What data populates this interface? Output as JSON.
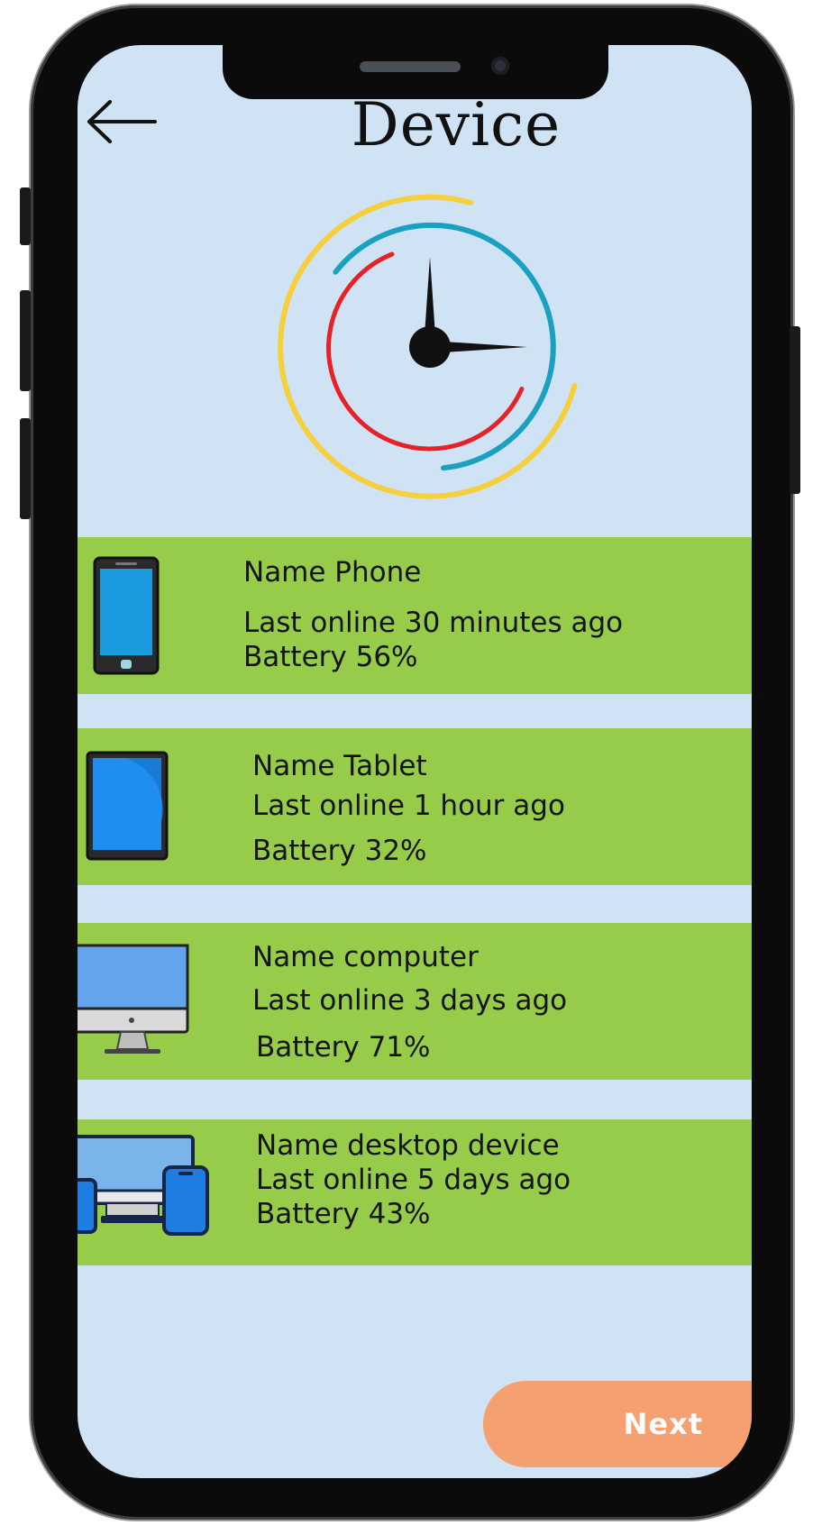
{
  "header": {
    "title": "Device",
    "back_icon": "arrow-left-icon"
  },
  "hero": {
    "icon": "clock-icon"
  },
  "devices": [
    {
      "icon": "smartphone-icon",
      "name": "Name Phone",
      "last_online": "Last online 30 minutes ago",
      "battery": "Battery 56%"
    },
    {
      "icon": "tablet-icon",
      "name": "Name Tablet",
      "last_online": "Last online 1 hour ago",
      "battery": "Battery 32%"
    },
    {
      "icon": "computer-icon",
      "name": "Name computer",
      "last_online": "Last online 3 days ago",
      "battery": "Battery 71%"
    },
    {
      "icon": "multi-device-icon",
      "name": "Name desktop device",
      "last_online": "Last online 5 days ago",
      "battery": "Battery 43%"
    }
  ],
  "footer": {
    "next_label": "Next"
  },
  "colors": {
    "screen_background": "#cfe3f5",
    "card_background": "#97cb4a",
    "next_button": "#f4a070",
    "device_screen_blue": "#1a9be0",
    "clock_yellow": "#f6cf3c",
    "clock_teal": "#1aa0c0",
    "clock_red": "#e62228"
  }
}
